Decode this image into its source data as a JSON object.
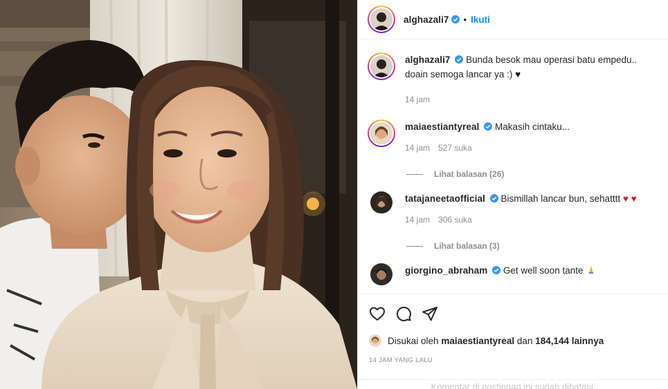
{
  "post": {
    "author": "alghazali7",
    "follow_label": "Ikuti",
    "caption": "Bunda besok mau operasi batu empedu.. doain semoga lancar ya :)",
    "caption_time": "14 jam"
  },
  "comments": [
    {
      "user": "maiaestiantyreal",
      "text": "Makasih cintaku...",
      "time": "14 jam",
      "likes": "527 suka",
      "replies": "Lihat balasan (26)"
    },
    {
      "user": "tatajaneetaofficial",
      "text": "Bismillah lancar bun, sehatttt",
      "time": "14 jam",
      "likes": "306 suka",
      "replies": "Lihat balasan (3)"
    },
    {
      "user": "giorgino_abraham",
      "text": "Get well soon tante"
    }
  ],
  "likes": {
    "prefix": "Disukai oleh",
    "user": "maiaestiantyreal",
    "connector": "dan",
    "count": "184,144 lainnya"
  },
  "timestamp": "14 JAM YANG LALU",
  "comments_limited": "Komentar di postingan ini sudah dibatasi.",
  "colors": {
    "accent": "#0095f6",
    "muted": "#8e8e8e",
    "verified": "#3897f0"
  },
  "icons": [
    "heart-outline-icon",
    "comment-icon",
    "share-icon",
    "verified-badge-icon"
  ]
}
